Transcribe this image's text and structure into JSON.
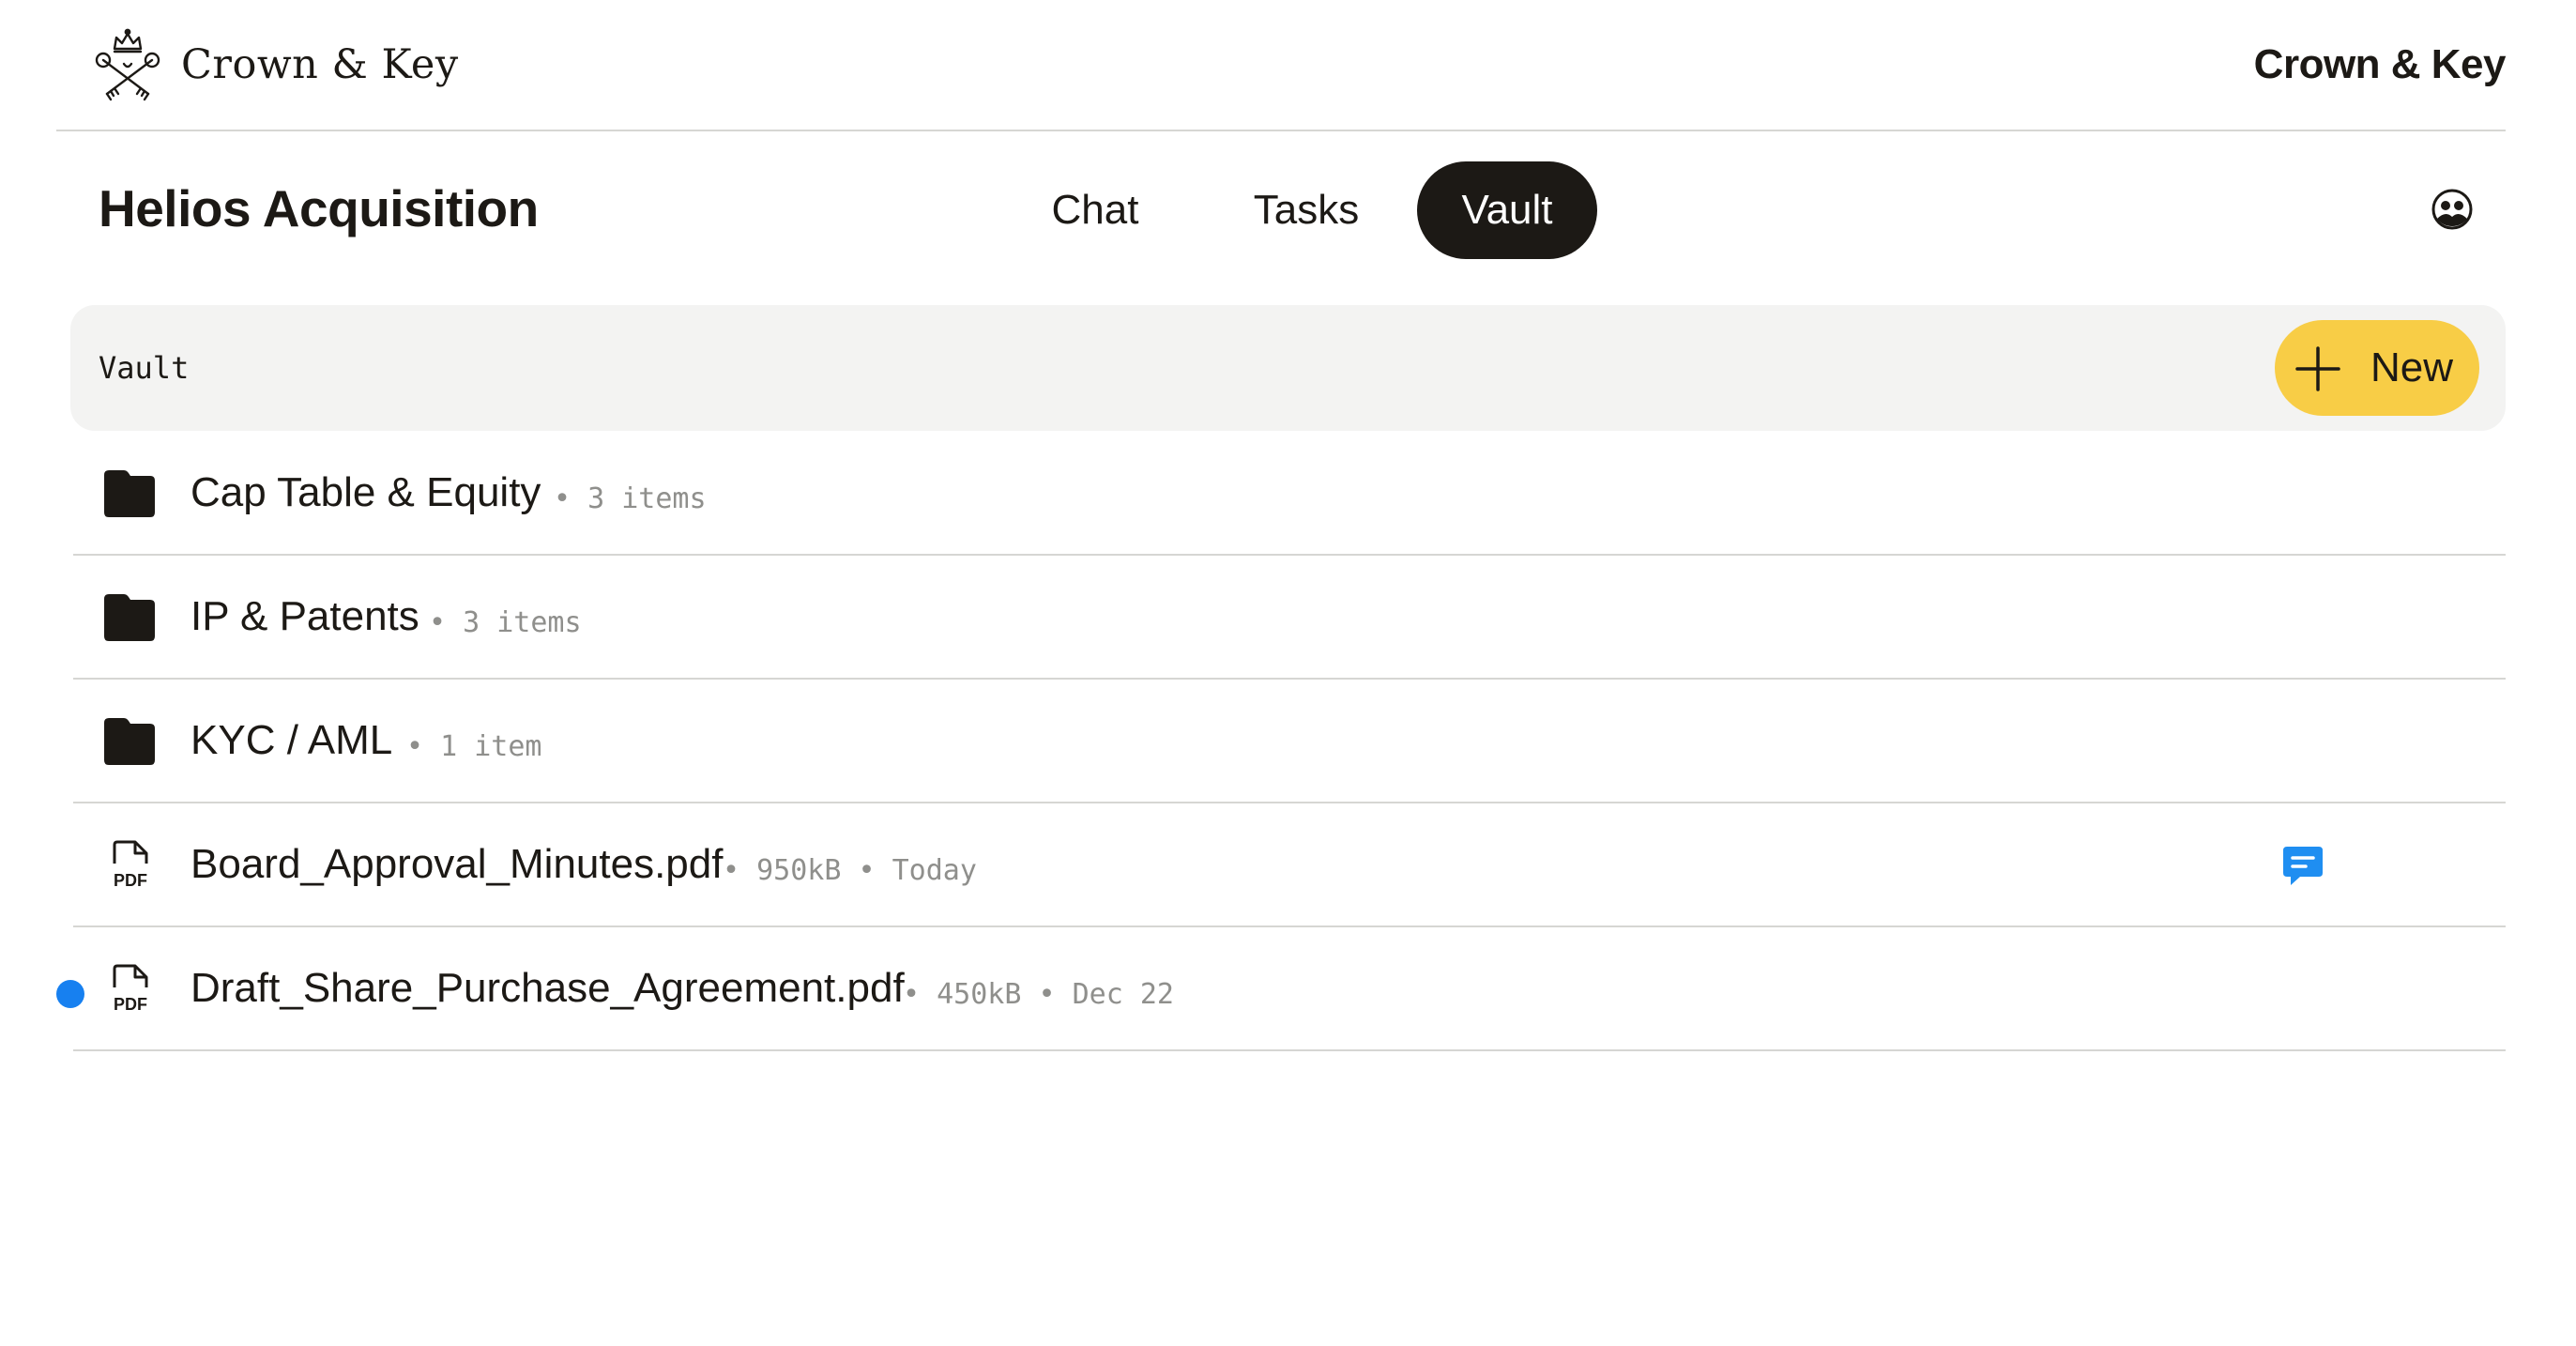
{
  "brand": {
    "name": "Crown & Key",
    "right_label": "Crown & Key",
    "logo_icon": "crossed-keys-crest-icon"
  },
  "project": {
    "title": "Helios Acquisition"
  },
  "tabs": [
    {
      "label": "Chat",
      "active": false
    },
    {
      "label": "Tasks",
      "active": false
    },
    {
      "label": "Vault",
      "active": true
    }
  ],
  "account_icon": "account-group-icon",
  "toolbar": {
    "breadcrumb": "Vault",
    "new_label": "New"
  },
  "items": [
    {
      "type": "folder",
      "name": "Cap Table & Equity",
      "meta": "• 3 items",
      "unread": false,
      "has_comment": false
    },
    {
      "type": "folder",
      "name": "IP & Patents",
      "meta": "• 3 items",
      "unread": false,
      "has_comment": false
    },
    {
      "type": "folder",
      "name": "KYC / AML",
      "meta": "• 1 item",
      "unread": false,
      "has_comment": false
    },
    {
      "type": "pdf",
      "name": "Board_Approval_Minutes.pdf",
      "meta": "• 950kB • Today",
      "unread": false,
      "has_comment": true
    },
    {
      "type": "pdf",
      "name": "Draft_Share_Purchase_Agreement.pdf",
      "meta": "• 450kB • Dec 22",
      "unread": true,
      "has_comment": false
    }
  ],
  "pdf_icon_label": "PDF",
  "colors": {
    "ink": "#1c1915",
    "accent_yellow": "#f8cd46",
    "unread_blue": "#1780f0",
    "comment_blue": "#1f8ef1",
    "toolbar_bg": "#f3f3f2",
    "divider": "#d6d6d3"
  }
}
